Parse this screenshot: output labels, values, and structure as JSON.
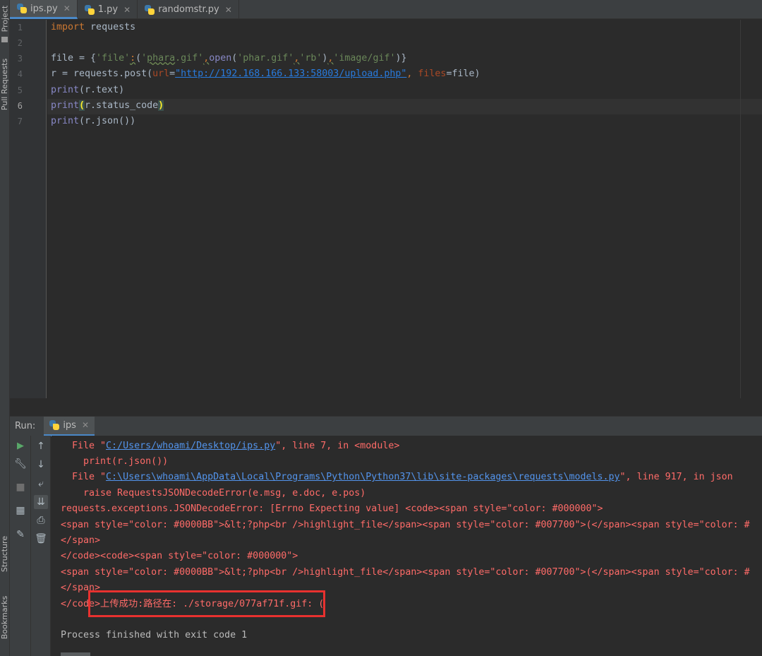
{
  "side_tabs": {
    "project": "Project",
    "pull_requests": "Pull Requests",
    "structure": "Structure",
    "bookmarks": "Bookmarks"
  },
  "editor_tabs": [
    {
      "label": "ips.py",
      "active": true
    },
    {
      "label": "1.py",
      "active": false
    },
    {
      "label": "randomstr.py",
      "active": false
    }
  ],
  "gutter": {
    "lines": [
      "1",
      "2",
      "3",
      "4",
      "5",
      "6",
      "7"
    ],
    "current_line": "6"
  },
  "code": {
    "l1": {
      "kw": "import",
      "rest": " requests"
    },
    "l3": {
      "a": "file = {",
      "b": "'file'",
      "c": ":",
      "d": "(",
      "e": "'",
      "f": "phara",
      "g": ".gif'",
      "h": ",",
      "i": "open",
      "j": "(",
      "k": "'phar.gif'",
      "l": ",",
      "m": "'rb'",
      "n": ")",
      "o": ",",
      "p": "'image/gif'",
      "q": ")}"
    },
    "l4": {
      "a": "r = requests.post(",
      "b": "url",
      "c": "=",
      "d": "\"http://192.168.166.133:58003/upload.php\"",
      "e": ", ",
      "f": "files",
      "g": "=file)"
    },
    "l5": {
      "a": "print",
      "b": "(r.text)"
    },
    "l6": {
      "a": "print",
      "b": "(",
      "c": "r.status_code",
      "d": ")"
    },
    "l7": {
      "a": "print",
      "b": "(r.json())"
    }
  },
  "run": {
    "label": "Run:",
    "tab": "ips"
  },
  "toolbar_icons": [
    "run-icon",
    "up-arrow-icon",
    "wrench-icon",
    "down-arrow-icon",
    "stop-icon",
    "soft-wrap-icon",
    "layout-icon",
    "scroll-to-end-icon",
    "print-icon",
    "pin-icon",
    "trash-icon"
  ],
  "console": {
    "l1": {
      "a": "  File \"",
      "b": "C:/Users/whoami/Desktop/ips.py",
      "c": "\", line 7, in <module>"
    },
    "l2": "    print(r.json())",
    "l3": {
      "a": "  File \"",
      "b": "C:\\Users\\whoami\\AppData\\Local\\Programs\\Python\\Python37\\lib\\site-packages\\requests\\models.py",
      "c": "\", line 917, in json"
    },
    "l4": "    raise RequestsJSONDecodeError(e.msg, e.doc, e.pos)",
    "l5": "requests.exceptions.JSONDecodeError: [Errno Expecting value] <code><span style=\"color: #000000\">",
    "l6": "<span style=\"color: #0000BB\">&lt;?php<br />highlight_file</span><span style=\"color: #007700\">(</span><span style=\"color: #",
    "l7": "</span>",
    "l8": "</code><code><span style=\"color: #000000\">",
    "l9": "<span style=\"color: #0000BB\">&lt;?php<br />highlight_file</span><span style=\"color: #007700\">(</span><span style=\"color: #",
    "l10": "</span>",
    "l11": "</code>上传成功:路径在: ./storage/077af71f.gif: (",
    "l12": "Process finished with exit code 1"
  },
  "colors": {
    "highlight_box": "#e8312f",
    "error_text": "#ff6b68",
    "accent": "#4a88c7"
  }
}
